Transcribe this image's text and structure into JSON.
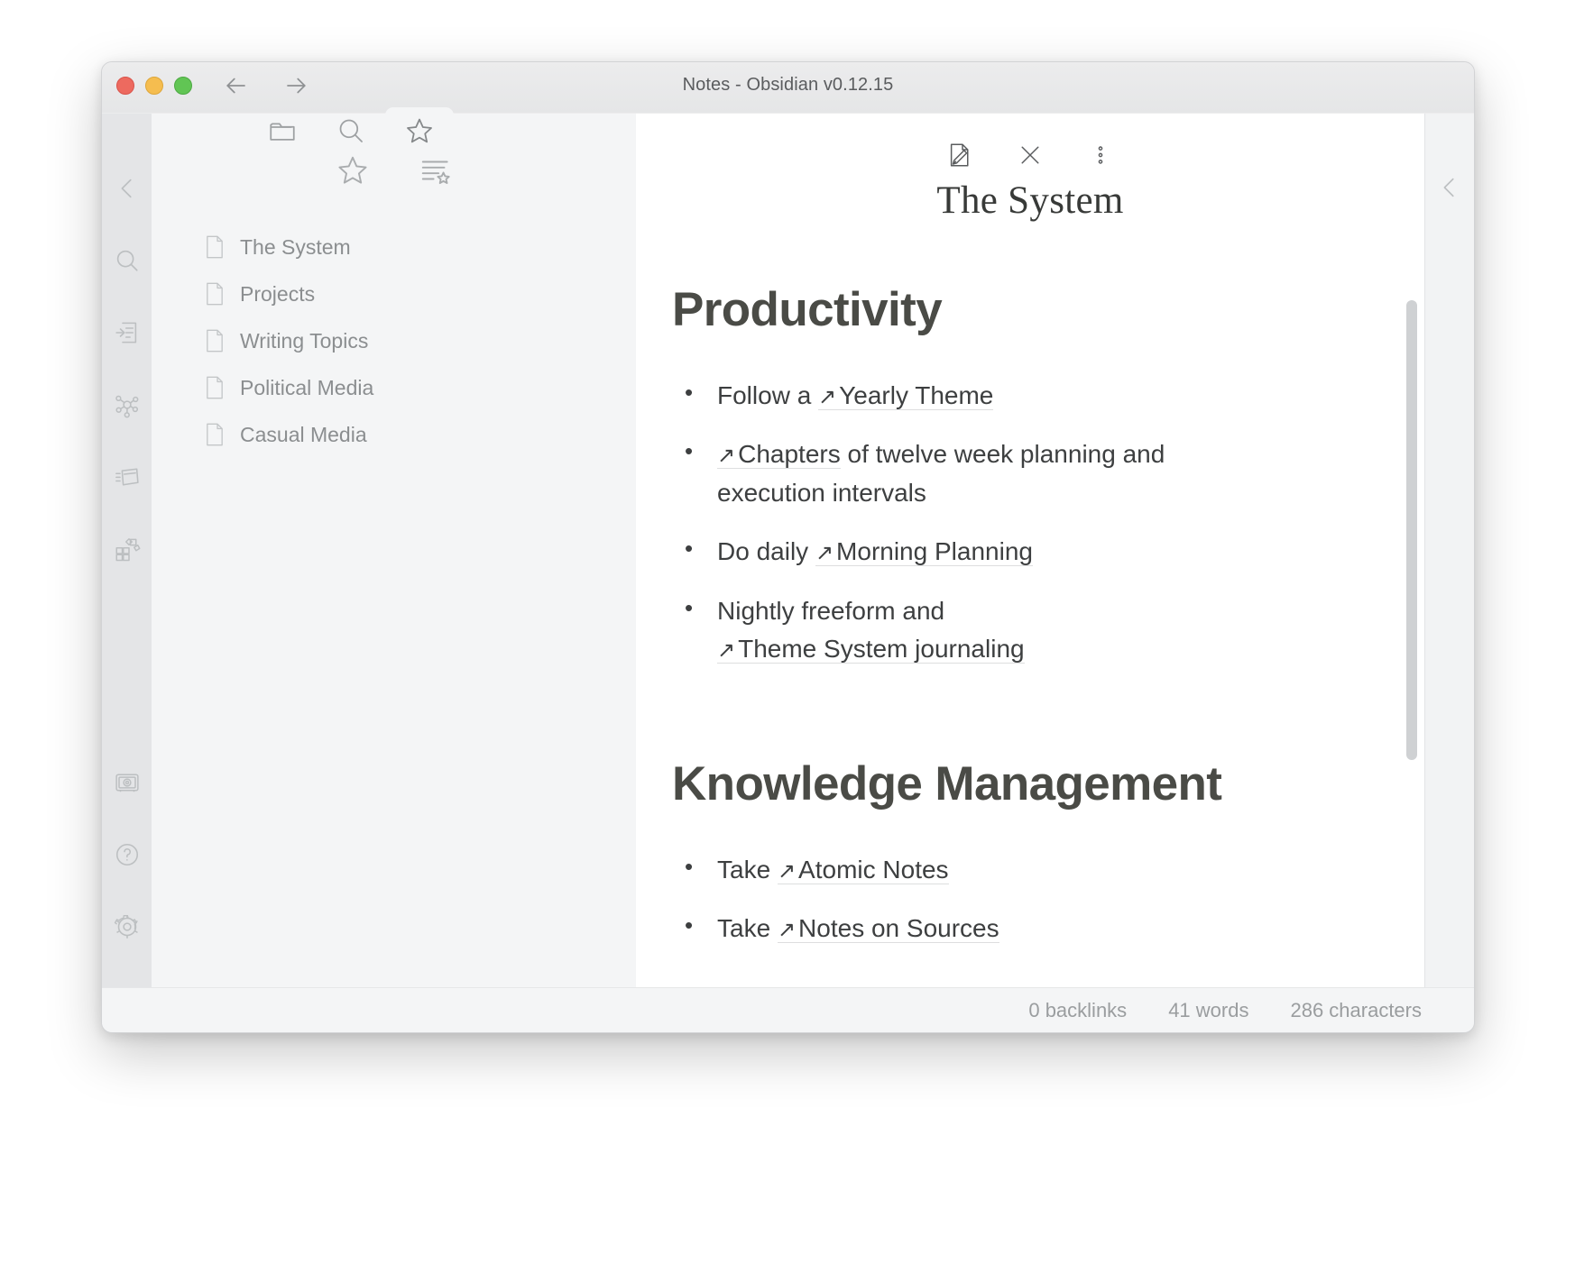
{
  "window": {
    "title": "Notes - Obsidian v0.12.15",
    "traffic_lights": {
      "close_label": "Close",
      "minimize_label": "Minimize",
      "zoom_label": "Zoom"
    },
    "nav": {
      "back_label": "Back",
      "forward_label": "Forward"
    }
  },
  "tabs": [
    {
      "id": "files",
      "icon": "folder-icon",
      "label": "Files",
      "active": false
    },
    {
      "id": "search",
      "icon": "search-icon",
      "label": "Search",
      "active": false
    },
    {
      "id": "starred",
      "icon": "star-icon",
      "label": "Starred",
      "active": true
    }
  ],
  "ribbon": {
    "items": [
      {
        "id": "collapse",
        "icon": "chevron-left-icon",
        "label": "Collapse sidebar"
      },
      {
        "id": "search",
        "icon": "search-icon",
        "label": "Search"
      },
      {
        "id": "quick-switcher",
        "icon": "quick-switcher-icon",
        "label": "Quick switcher"
      },
      {
        "id": "graph-view",
        "icon": "graph-icon",
        "label": "Graph view"
      },
      {
        "id": "daily-note",
        "icon": "daily-note-icon",
        "label": "Daily note"
      },
      {
        "id": "command-palette",
        "icon": "command-palette-icon",
        "label": "Command palette"
      }
    ],
    "bottom_items": [
      {
        "id": "vault",
        "icon": "vault-icon",
        "label": "Open another vault"
      },
      {
        "id": "help",
        "icon": "help-icon",
        "label": "Help"
      },
      {
        "id": "settings",
        "icon": "gear-icon",
        "label": "Settings"
      }
    ]
  },
  "starred_pane": {
    "actions": [
      {
        "id": "star",
        "icon": "star-icon",
        "label": "Star current file"
      },
      {
        "id": "sort-list",
        "icon": "list-star-icon",
        "label": "Change sort order"
      }
    ],
    "files": [
      {
        "icon": "document-icon",
        "name": "The System"
      },
      {
        "icon": "document-icon",
        "name": "Projects"
      },
      {
        "icon": "document-icon",
        "name": "Writing Topics"
      },
      {
        "icon": "document-icon",
        "name": "Political Media"
      },
      {
        "icon": "document-icon",
        "name": "Casual Media"
      }
    ]
  },
  "note": {
    "actions": [
      {
        "id": "edit",
        "icon": "edit-document-icon",
        "label": "Edit"
      },
      {
        "id": "close",
        "icon": "close-icon",
        "label": "Close"
      },
      {
        "id": "more",
        "icon": "more-vertical-icon",
        "label": "More options"
      }
    ],
    "title": "The System",
    "sections": [
      {
        "heading": "Productivity",
        "bullets": [
          {
            "parts": [
              {
                "type": "text",
                "value": "Follow a "
              },
              {
                "type": "link",
                "value": "Yearly Theme"
              }
            ]
          },
          {
            "parts": [
              {
                "type": "link",
                "value": "Chapters"
              },
              {
                "type": "text",
                "value": " of twelve week planning and execution intervals"
              }
            ]
          },
          {
            "parts": [
              {
                "type": "text",
                "value": "Do daily "
              },
              {
                "type": "link",
                "value": "Morning Planning"
              }
            ]
          },
          {
            "parts": [
              {
                "type": "text",
                "value": "Nightly freeform and "
              },
              {
                "type": "link",
                "value": "Theme System journaling"
              }
            ]
          }
        ]
      },
      {
        "heading": "Knowledge Management",
        "bullets": [
          {
            "parts": [
              {
                "type": "text",
                "value": "Take "
              },
              {
                "type": "link",
                "value": "Atomic Notes"
              }
            ]
          },
          {
            "parts": [
              {
                "type": "text",
                "value": "Take "
              },
              {
                "type": "link",
                "value": "Notes on Sources"
              }
            ]
          }
        ]
      }
    ],
    "link_arrow_glyph": "↗"
  },
  "right_rail": {
    "items": [
      {
        "id": "collapse-right",
        "icon": "chevron-left-icon",
        "label": "Collapse right sidebar"
      }
    ]
  },
  "status_bar": {
    "backlinks": "0 backlinks",
    "words": "41 words",
    "characters": "286 characters"
  },
  "colors": {
    "window_chrome": "#e8e9ea",
    "pane_background": "#f4f5f6",
    "note_background": "#ffffff",
    "heading": "#4a4b46",
    "body_text": "#3d3f40",
    "muted_text": "#8b8e90",
    "icon_muted": "#bcbfc1",
    "traffic_red": "#ed6a5f",
    "traffic_yellow": "#f5bd4f",
    "traffic_green": "#61c554"
  }
}
